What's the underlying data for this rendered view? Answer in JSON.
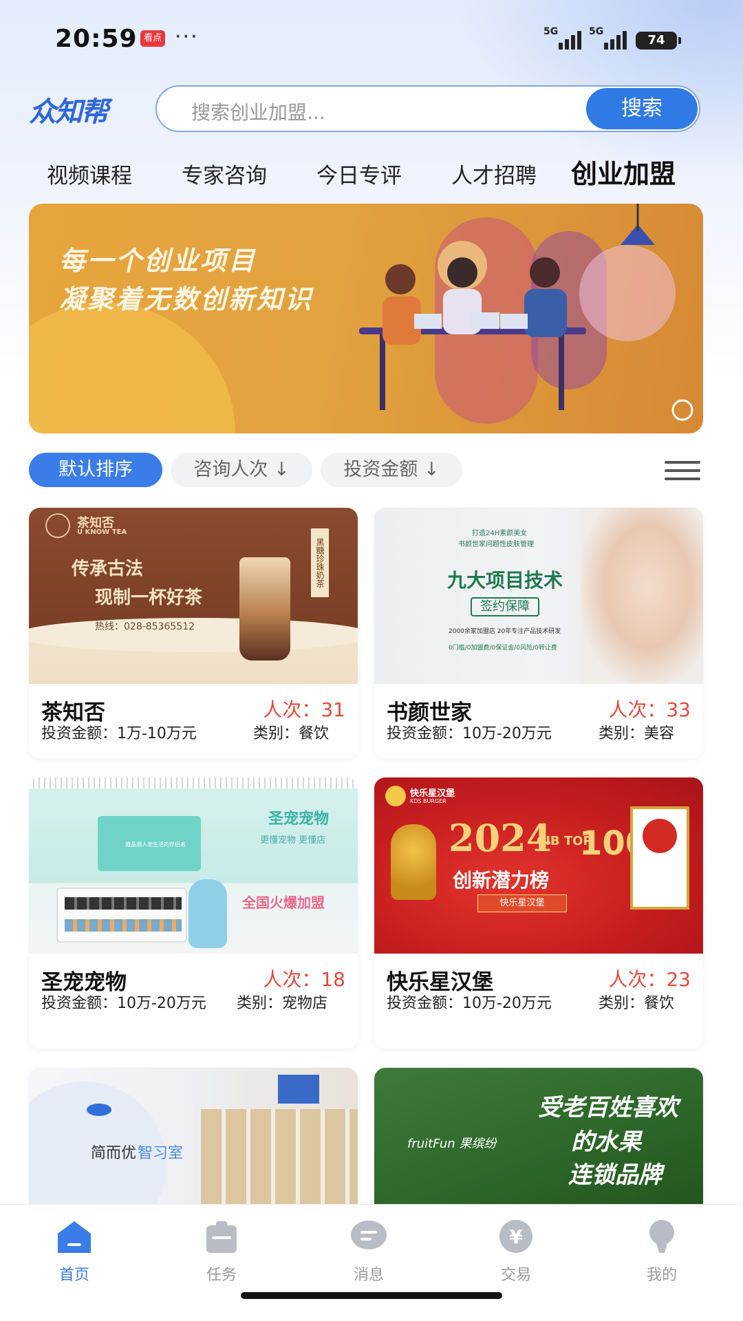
{
  "status_bar": {
    "time": "20:59",
    "app_badge": "看点",
    "more": "···",
    "network1": "5G",
    "network2": "5G",
    "battery": "74"
  },
  "header": {
    "logo": "众知帮",
    "search_placeholder": "搜索创业加盟...",
    "search_button": "搜索"
  },
  "tabs": [
    {
      "label": "视频课程",
      "active": false
    },
    {
      "label": "专家咨询",
      "active": false
    },
    {
      "label": "今日专评",
      "active": false
    },
    {
      "label": "人才招聘",
      "active": false
    },
    {
      "label": "创业加盟",
      "active": true
    }
  ],
  "banner": {
    "line1": "每一个创业项目",
    "line2": "凝聚着无数创新知识"
  },
  "filters": {
    "default": "默认排序",
    "consult": "咨询人次 ↓",
    "invest": "投资金额 ↓"
  },
  "cards": [
    {
      "name": "茶知否",
      "count": "人次：31",
      "invest": "投资金额：1万-10万元",
      "category": "类别：餐饮",
      "img_brand": "茶知否",
      "img_brand_en": "U KNOW TEA",
      "img_line1": "传承古法",
      "img_line2": "现制一杯好茶",
      "img_phone": "热线：028-85365512",
      "img_tag": "黑糖珍珠奶茶"
    },
    {
      "name": "书颜世家",
      "count": "人次：33",
      "invest": "投资金额：10万-20万元",
      "category": "类别：美容",
      "img_small": "打造24H素颜美女",
      "img_small2": "书颜世家问题性皮肤管理",
      "img_big": "九大项目技术",
      "img_sub": "签约保障",
      "img_note": "2000余家加盟店 20年专注产品技术研发",
      "img_note2": "0门槛/0加盟费/0保证金/0风险/0转让费"
    },
    {
      "name": "圣宠宠物",
      "count": "人次：18",
      "invest": "投资金额：10万-20万元",
      "category": "类别：宠物店",
      "img_title": "圣宠宠物",
      "img_sub": "更懂宠物 更懂店",
      "img_cta": "全国火爆加盟",
      "img_sign": "趣品潮人宠生活的伴侣者"
    },
    {
      "name": "快乐星汉堡",
      "count": "人次：23",
      "invest": "投资金额：10万-20万元",
      "category": "类别：餐饮",
      "img_brand": "快乐星汉堡",
      "img_brand_en": "KDS BURGER",
      "img_year": "2024",
      "img_cib": "CIB TOP",
      "img_100": "100",
      "img_rank": "创新潜力榜",
      "img_ribbon": "快乐星汉堡"
    },
    {
      "name": "简而优智习室",
      "img_title_a": "简而优",
      "img_title_b": "智习室"
    },
    {
      "name": "果缤纷",
      "img_slogan1": "受老百姓喜欢",
      "img_slogan2": "的水果",
      "img_slogan3": "连锁品牌",
      "img_brand": "fruitFun 果缤纷"
    }
  ],
  "tabbar": [
    {
      "label": "首页",
      "icon": "home-icon",
      "active": true
    },
    {
      "label": "任务",
      "icon": "task-icon",
      "active": false
    },
    {
      "label": "消息",
      "icon": "message-icon",
      "active": false
    },
    {
      "label": "交易",
      "icon": "trade-icon",
      "active": false
    },
    {
      "label": "我的",
      "icon": "profile-icon",
      "active": false
    }
  ],
  "colors": {
    "accent": "#2f7ae5",
    "count_red": "#e2493e",
    "banner_orange": "#e2a23e"
  }
}
